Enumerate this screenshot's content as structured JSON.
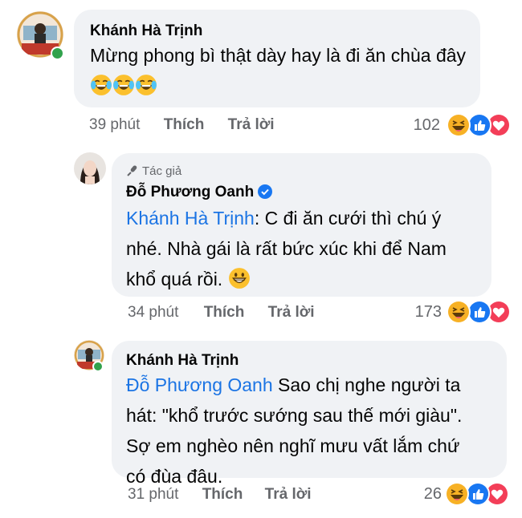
{
  "comments": [
    {
      "author": "Khánh Hà Trịnh",
      "text": "Mừng phong bì thật dày hay là đi ăn chùa đây",
      "emojis": [
        "laugh-cry-emoji",
        "laugh-cry-emoji",
        "laugh-cry-emoji"
      ],
      "time": "39 phút",
      "like_label": "Thích",
      "reply_label": "Trả lời",
      "reaction_count": "102",
      "reactions": [
        "haha",
        "like",
        "love"
      ]
    },
    {
      "author_tag": "Tác giả",
      "author": "Đỗ Phương Oanh",
      "verified": true,
      "mention": "Khánh Hà Trịnh",
      "text_line1": ": C đi ăn cưới thì chú ý",
      "text_line2": "nhé. Nhà gái là rất bức xúc khi để Nam",
      "text_line3": "khổ quá rồi. ",
      "emojis": [
        "grin-emoji"
      ],
      "time": "34 phút",
      "like_label": "Thích",
      "reply_label": "Trả lời",
      "reaction_count": "173",
      "reactions": [
        "haha",
        "like",
        "love"
      ]
    },
    {
      "author": "Khánh Hà Trịnh",
      "mention": "Đỗ Phương Oanh",
      "text_line1": " Sao chị nghe người ta",
      "text_line2": "hát: \"khổ trước sướng sau thế mới giàu\".",
      "text_line3": "Sợ em nghèo nên nghĩ mưu vất lắm chứ",
      "text_line4": "có đùa đâu.",
      "time": "31 phút",
      "like_label": "Thích",
      "reply_label": "Trả lời",
      "reaction_count": "26",
      "reactions": [
        "haha",
        "like",
        "love"
      ]
    }
  ],
  "colors": {
    "bubble": "#f0f2f5",
    "mention": "#1b74e4",
    "meta": "#65676b",
    "online": "#31a24c",
    "like": "#1877f2",
    "love": "#f33e58",
    "haha": "#f7b125"
  }
}
